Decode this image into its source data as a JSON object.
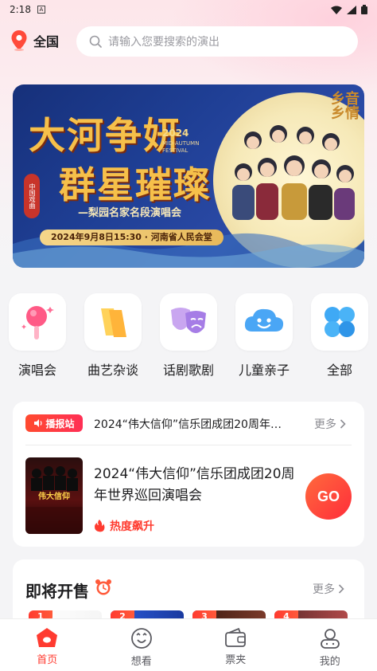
{
  "status_bar": {
    "time": "2:18",
    "notification_icon": "A"
  },
  "location": {
    "label": "全国"
  },
  "search": {
    "placeholder": "请输入您要搜索的演出"
  },
  "banner": {
    "title_line1": "大河争妍",
    "title_line2": "群星璀璨",
    "year": "2024",
    "festival": "MID-AUTUMN FESTIVAL",
    "subtitle": "—梨园名家名段演唱会",
    "side_tag": "中国戏曲",
    "date_line": "2024年9月8日15:30 · 河南省人民会堂",
    "logo": "乡音乡情"
  },
  "categories": [
    {
      "label": "演唱会",
      "icon": "microphone-icon"
    },
    {
      "label": "曲艺杂谈",
      "icon": "ticket-icon"
    },
    {
      "label": "话剧歌剧",
      "icon": "theater-masks-icon"
    },
    {
      "label": "儿童亲子",
      "icon": "smiley-cloud-icon"
    },
    {
      "label": "全部",
      "icon": "four-petals-icon"
    }
  ],
  "broadcast": {
    "badge": "播报站",
    "text": "2024“伟大信仰”信乐团成团20周年世界巡回演唱会",
    "more": "更多"
  },
  "featured_show": {
    "poster_text": "伟大信仰",
    "title": "2024“伟大信仰”信乐团成团20周年世界巡回演唱会",
    "hot_label": "热度飙升",
    "go_label": "GO"
  },
  "upcoming": {
    "title": "即将开售",
    "more": "更多",
    "ranks": [
      "1",
      "2",
      "3",
      "4"
    ]
  },
  "tabbar": [
    {
      "label": "首页",
      "icon": "home-icon",
      "active": true
    },
    {
      "label": "想看",
      "icon": "want-icon",
      "active": false
    },
    {
      "label": "票夹",
      "icon": "wallet-icon",
      "active": false
    },
    {
      "label": "我的",
      "icon": "profile-icon",
      "active": false
    }
  ],
  "colors": {
    "accent": "#ff3b30",
    "banner_bg": "#1f3f95",
    "gold": "#f6c04a"
  }
}
